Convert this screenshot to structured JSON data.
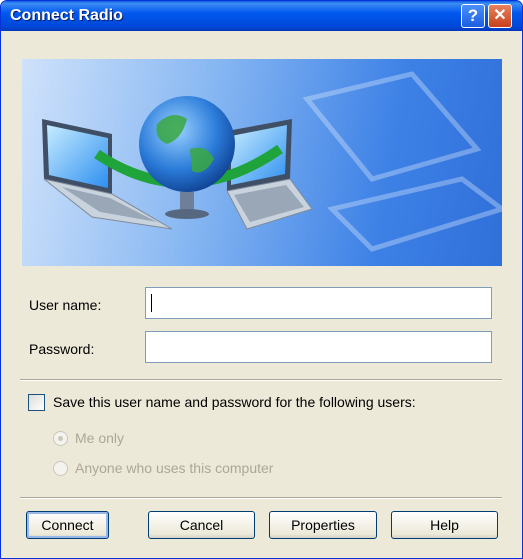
{
  "window": {
    "title": "Connect Radio",
    "help_glyph": "?",
    "close_glyph": "✕"
  },
  "form": {
    "username_label": "User name:",
    "username_value": "",
    "password_label": "Password:",
    "password_value": ""
  },
  "save": {
    "label": "Save this user name and password for the following users:",
    "checked": false,
    "options": [
      {
        "label": "Me only",
        "selected": true,
        "enabled": false
      },
      {
        "label": "Anyone who uses this computer",
        "selected": false,
        "enabled": false
      }
    ]
  },
  "buttons": {
    "connect": "Connect",
    "cancel": "Cancel",
    "properties": "Properties",
    "help": "Help"
  },
  "colors": {
    "titlebar": "#0058ee",
    "face": "#ece9d8",
    "border": "#0831d9"
  }
}
